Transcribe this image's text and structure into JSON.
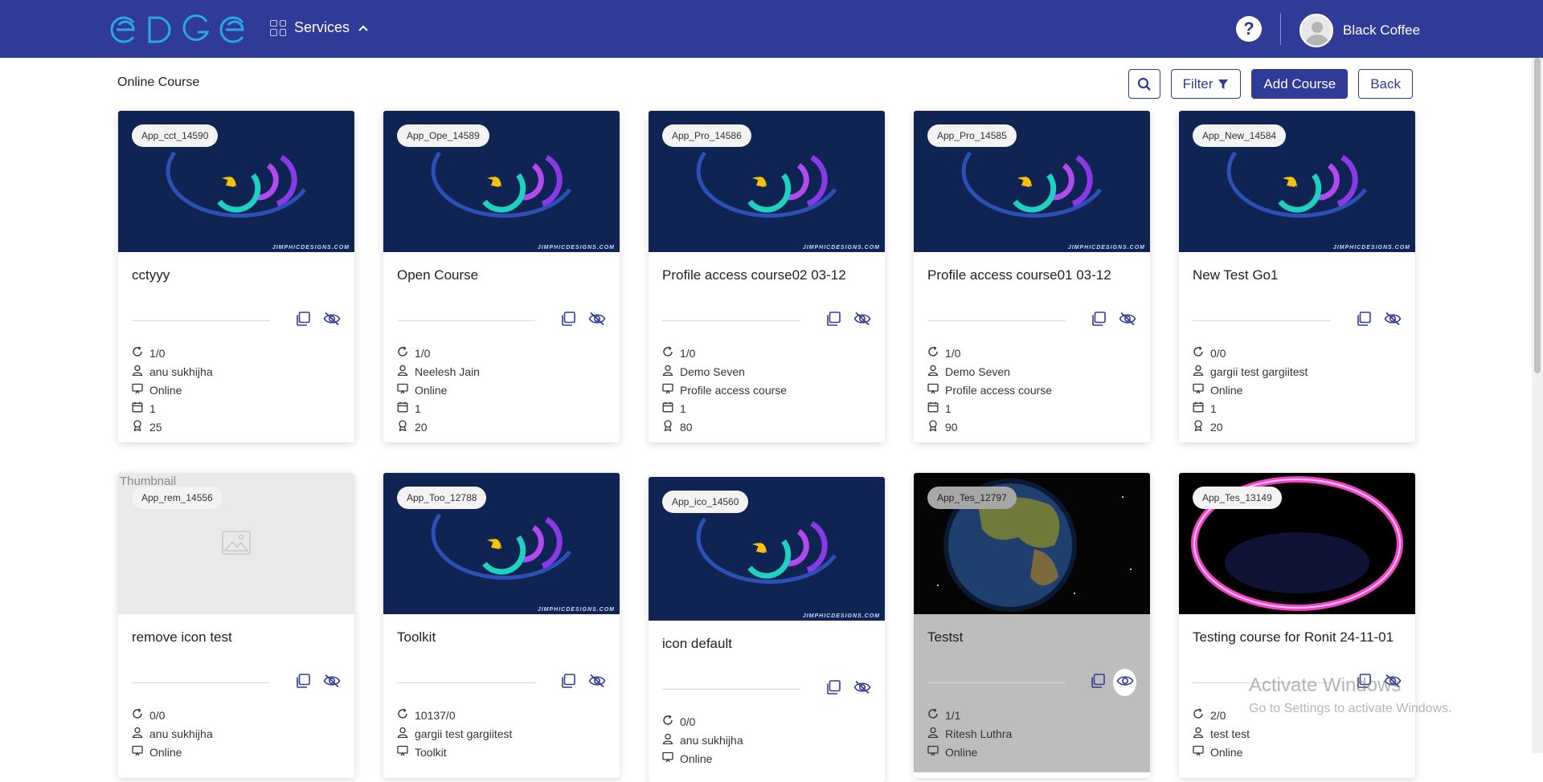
{
  "header": {
    "logo_text": "EDGE",
    "services_label": "Services",
    "help_label": "?",
    "user_name": "Black Coffee"
  },
  "page": {
    "title": "Online Course",
    "filter_label": "Filter",
    "add_course_label": "Add Course",
    "back_label": "Back"
  },
  "courses": [
    {
      "tag": "App_cct_14590",
      "title": "cctyyy",
      "progress": "1/0",
      "author": "anu sukhijha",
      "mode": "Online",
      "days": "1",
      "points": "25",
      "thumbnail": "logo",
      "visibility": "hidden"
    },
    {
      "tag": "App_Ope_14589",
      "title": "Open Course",
      "progress": "1/0",
      "author": "Neelesh Jain",
      "mode": "Online",
      "days": "1",
      "points": "20",
      "thumbnail": "logo",
      "visibility": "hidden"
    },
    {
      "tag": "App_Pro_14586",
      "title": "Profile access course02 03-12",
      "progress": "1/0",
      "author": "Demo Seven",
      "mode": "Profile access course",
      "days": "1",
      "points": "80",
      "thumbnail": "logo",
      "visibility": "hidden"
    },
    {
      "tag": "App_Pro_14585",
      "title": "Profile access course01 03-12",
      "progress": "1/0",
      "author": "Demo Seven",
      "mode": "Profile access course",
      "days": "1",
      "points": "90",
      "thumbnail": "logo",
      "visibility": "hidden"
    },
    {
      "tag": "App_New_14584",
      "title": "New Test Go1",
      "progress": "0/0",
      "author": "gargii test gargiitest",
      "mode": "Online",
      "days": "1",
      "points": "20",
      "thumbnail": "logo",
      "visibility": "hidden"
    },
    {
      "tag": "App_rem_14556",
      "title": "remove icon test",
      "progress": "0/0",
      "author": "anu sukhijha",
      "mode": "Online",
      "thumbnail": "placeholder",
      "thumbnail_alt": "Thumbnail",
      "visibility": "hidden"
    },
    {
      "tag": "App_Too_12788",
      "title": "Toolkit",
      "progress": "10137/0",
      "author": "gargii test gargiitest",
      "mode": "Toolkit",
      "thumbnail": "logo",
      "visibility": "hidden"
    },
    {
      "tag": "App_ico_14560",
      "title": "icon default",
      "progress": "0/0",
      "author": "anu sukhijha",
      "mode": "Online",
      "thumbnail": "logo",
      "visibility": "hidden"
    },
    {
      "tag": "App_Tes_12797",
      "title": "Testst",
      "progress": "1/1",
      "author": "Ritesh Luthra",
      "mode": "Online",
      "thumbnail": "earth",
      "visibility": "visible"
    },
    {
      "tag": "App_Tes_13149",
      "title": "Testing course for Ronit 24-11-01",
      "progress": "2/0",
      "author": "test test",
      "mode": "Online",
      "thumbnail": "ring",
      "visibility": "hidden"
    }
  ],
  "credit_text": "JIMPHICDESIGNS.COM",
  "watermark": {
    "line1": "Activate Windows",
    "line2": "Go to Settings to activate Windows."
  },
  "colors": {
    "brand": "#303a97",
    "thumb_bg": "#0f2452"
  }
}
